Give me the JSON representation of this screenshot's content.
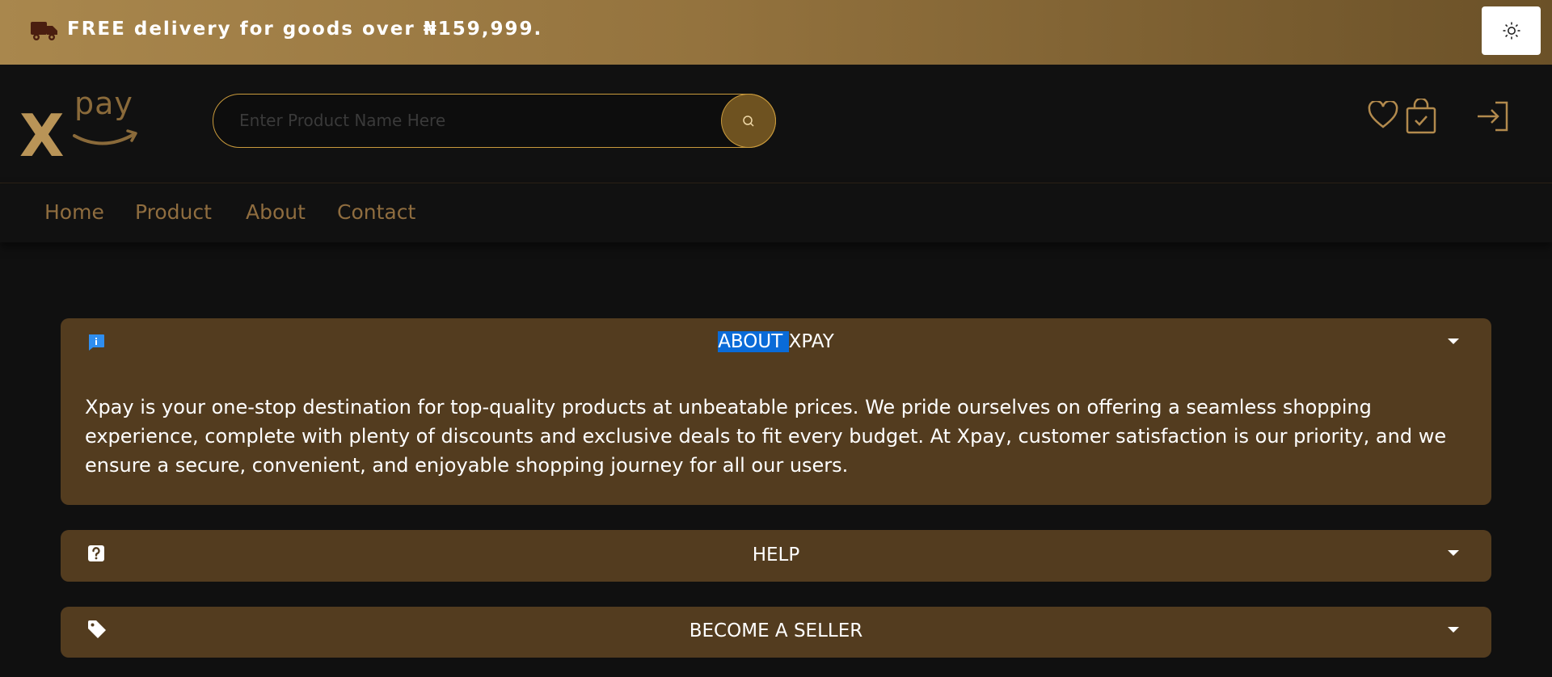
{
  "promo": {
    "text": "FREE delivery for goods over ₦159,999.",
    "icon": "truck-icon",
    "theme_toggle_icon": "sun-icon"
  },
  "header": {
    "logo": {
      "mark": "X",
      "wordmark": "pay"
    },
    "search": {
      "placeholder": "Enter Product Name Here",
      "value": "",
      "button_icon": "search-icon"
    },
    "icons": [
      "heart-icon",
      "shopping-bag-icon",
      "login-icon"
    ]
  },
  "nav": {
    "items": [
      "Home",
      "Product",
      "About",
      "Contact"
    ]
  },
  "accordion": [
    {
      "icon": "info-icon",
      "title_selected": "ABOUT ",
      "title_rest": "XPAY",
      "expanded": true,
      "body": "Xpay is your one-stop destination for top-quality products at unbeatable prices. We pride ourselves on offering a seamless shopping experience, complete with plenty of discounts and exclusive deals to fit every budget. At Xpay, customer satisfaction is our priority, and we ensure a secure, convenient, and enjoyable shopping journey for all our users."
    },
    {
      "icon": "question-icon",
      "title": "HELP",
      "expanded": false
    },
    {
      "icon": "tag-icon",
      "title": "BECOME A SELLER",
      "expanded": false
    }
  ],
  "colors": {
    "promo_gradient_start": "#a9874d",
    "promo_gradient_end": "#6b5128",
    "background": "#101010",
    "accent_gold": "#c99a3c",
    "nav_text": "#8f6d3f",
    "panel": "#533c1f",
    "selection": "#0a6bd8"
  }
}
